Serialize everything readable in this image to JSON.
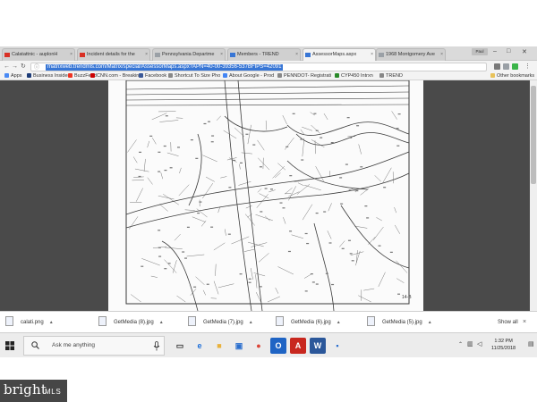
{
  "browser": {
    "tabs": [
      {
        "label": "Calatattnic - auplonH",
        "icon": "gmail-icon",
        "color": "#d93025"
      },
      {
        "label": "Incident details for the",
        "icon": "gmail-icon",
        "color": "#d93025"
      },
      {
        "label": "Pennsylvania Departme",
        "icon": "page-icon",
        "color": "#9aa0a6"
      },
      {
        "label": "Members - TREND",
        "icon": "page-icon",
        "color": "#3876d5"
      },
      {
        "label": "AssessorMaps.aspx",
        "icon": "page-icon",
        "color": "#3876d5",
        "active": true
      },
      {
        "label": "1968 Montgomery Ave",
        "icon": "page-icon",
        "color": "#9aa0a6"
      }
    ],
    "profile_label": "Paul",
    "url": "matrixweb.trendmls.com/Matrix/special/AssessorMaps.aspx?APN=40-00-39356-537BFIPS=42091",
    "bookmarks": [
      {
        "label": "Apps",
        "color": "#4a8af4"
      },
      {
        "label": "Business Insider",
        "color": "#1d3c78"
      },
      {
        "label": "BuzzFeed",
        "color": "#ee3322"
      },
      {
        "label": "CNN.com - Breaking",
        "color": "#cc0000"
      },
      {
        "label": "Facebook",
        "color": "#3b5998"
      },
      {
        "label": "Shortcut To Size Pho",
        "color": "#888888"
      },
      {
        "label": "About Google - Prod",
        "color": "#4285f4"
      },
      {
        "label": "PENNDOT- Registrati",
        "color": "#888888"
      },
      {
        "label": "CYP450 Intrxn",
        "color": "#2a8a2a"
      },
      {
        "label": "TREND",
        "color": "#888888"
      }
    ],
    "other_bookmarks": "Other bookmarks"
  },
  "downloads": {
    "items": [
      {
        "label": "calati.png"
      },
      {
        "label": "GetMedia (8).jpg"
      },
      {
        "label": "GetMedia (7).jpg"
      },
      {
        "label": "GetMedia (6).jpg"
      },
      {
        "label": "GetMedia (5).jpg"
      }
    ],
    "show_all": "Show all",
    "close": "×"
  },
  "taskbar": {
    "search_placeholder": "Ask me anything",
    "clock_time": "1:32 PM",
    "clock_date": "11/25/2018",
    "apps": [
      {
        "name": "task-view-icon",
        "glyph": "▭",
        "color": "#333333",
        "bg": "transparent"
      },
      {
        "name": "edge-icon",
        "glyph": "e",
        "color": "#1e6fd9",
        "bg": "transparent"
      },
      {
        "name": "file-explorer-icon",
        "glyph": "■",
        "color": "#e9b23c",
        "bg": "transparent"
      },
      {
        "name": "store-icon",
        "glyph": "▣",
        "color": "#2b6fce",
        "bg": "transparent"
      },
      {
        "name": "chrome-icon",
        "glyph": "●",
        "color": "#db4437",
        "bg": "transparent"
      },
      {
        "name": "outlook-icon",
        "glyph": "O",
        "color": "#ffffff",
        "bg": "#1f64c4"
      },
      {
        "name": "acrobat-icon",
        "glyph": "A",
        "color": "#ffffff",
        "bg": "#c8281f"
      },
      {
        "name": "word-icon",
        "glyph": "W",
        "color": "#ffffff",
        "bg": "#2b579a"
      },
      {
        "name": "generic-app-icon",
        "glyph": "▪",
        "color": "#2b6fce",
        "bg": "transparent"
      }
    ]
  },
  "map": {
    "label_bottom_right": "14-B"
  },
  "watermark": {
    "brand": "bright",
    "suffix": "MLS"
  }
}
